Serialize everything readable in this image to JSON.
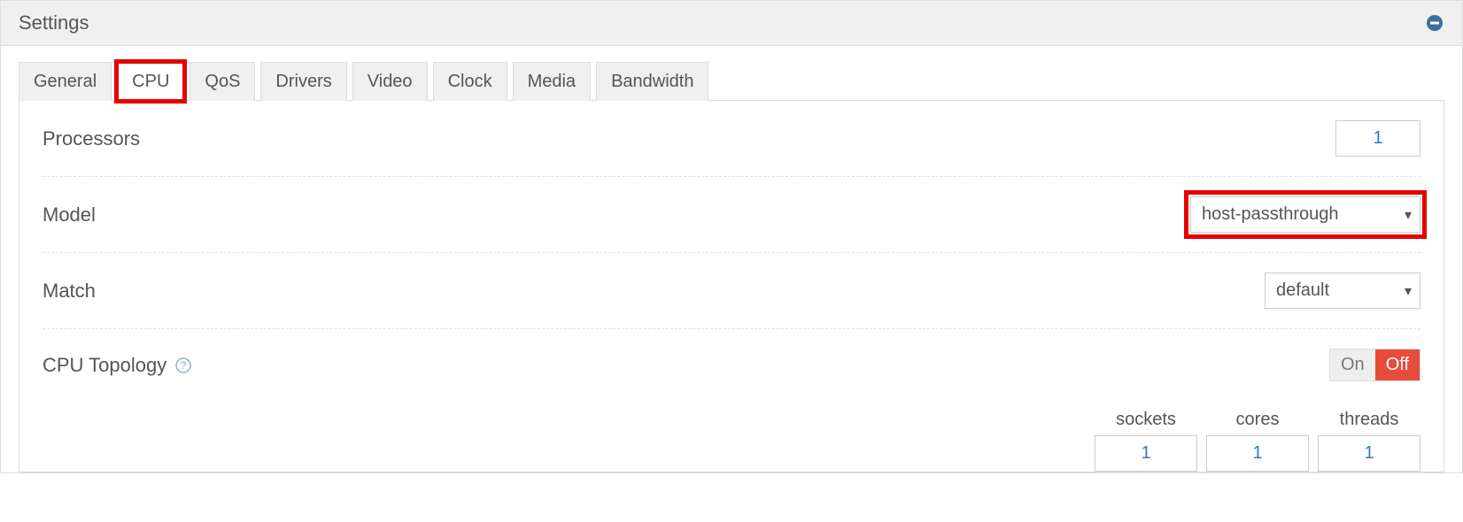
{
  "panel": {
    "title": "Settings"
  },
  "tabs": [
    {
      "label": "General"
    },
    {
      "label": "CPU"
    },
    {
      "label": "QoS"
    },
    {
      "label": "Drivers"
    },
    {
      "label": "Video"
    },
    {
      "label": "Clock"
    },
    {
      "label": "Media"
    },
    {
      "label": "Bandwidth"
    }
  ],
  "cpu": {
    "processors_label": "Processors",
    "processors_value": "1",
    "model_label": "Model",
    "model_value": "host-passthrough",
    "match_label": "Match",
    "match_value": "default",
    "topology_label": "CPU Topology",
    "toggle_on": "On",
    "toggle_off": "Off",
    "topology": {
      "sockets_label": "sockets",
      "cores_label": "cores",
      "threads_label": "threads",
      "sockets": "1",
      "cores": "1",
      "threads": "1"
    }
  }
}
